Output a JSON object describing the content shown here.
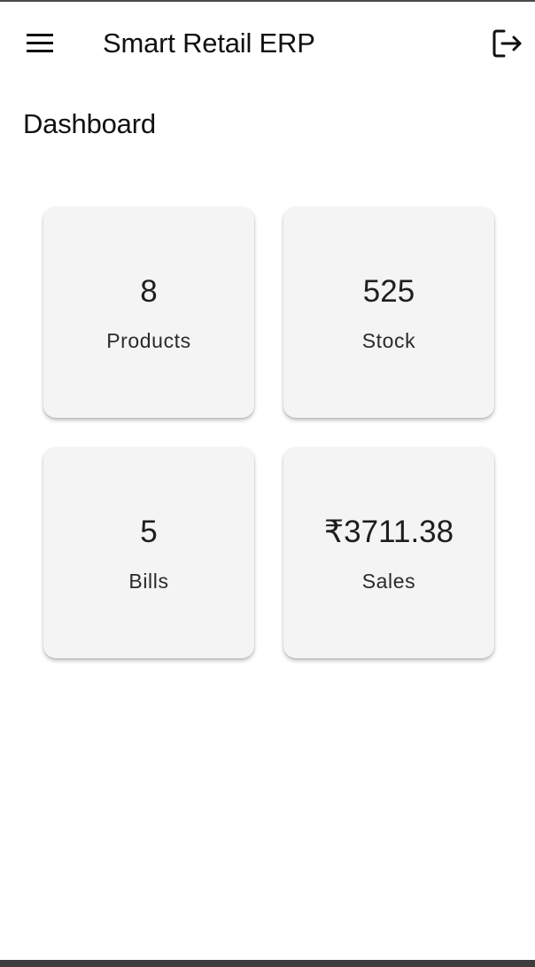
{
  "app_bar": {
    "title": "Smart Retail ERP",
    "menu_icon": "hamburger-menu-icon",
    "logout_icon": "logout-icon"
  },
  "page": {
    "title": "Dashboard"
  },
  "stats": [
    {
      "value": "8",
      "label": "Products"
    },
    {
      "value": "525",
      "label": "Stock"
    },
    {
      "value": "5",
      "label": "Bills"
    },
    {
      "value": "₹3711.38",
      "label": "Sales"
    }
  ],
  "colors": {
    "card_background": "#f4f4f4",
    "text": "#111111",
    "bottom_bar": "#3d3d3d"
  }
}
